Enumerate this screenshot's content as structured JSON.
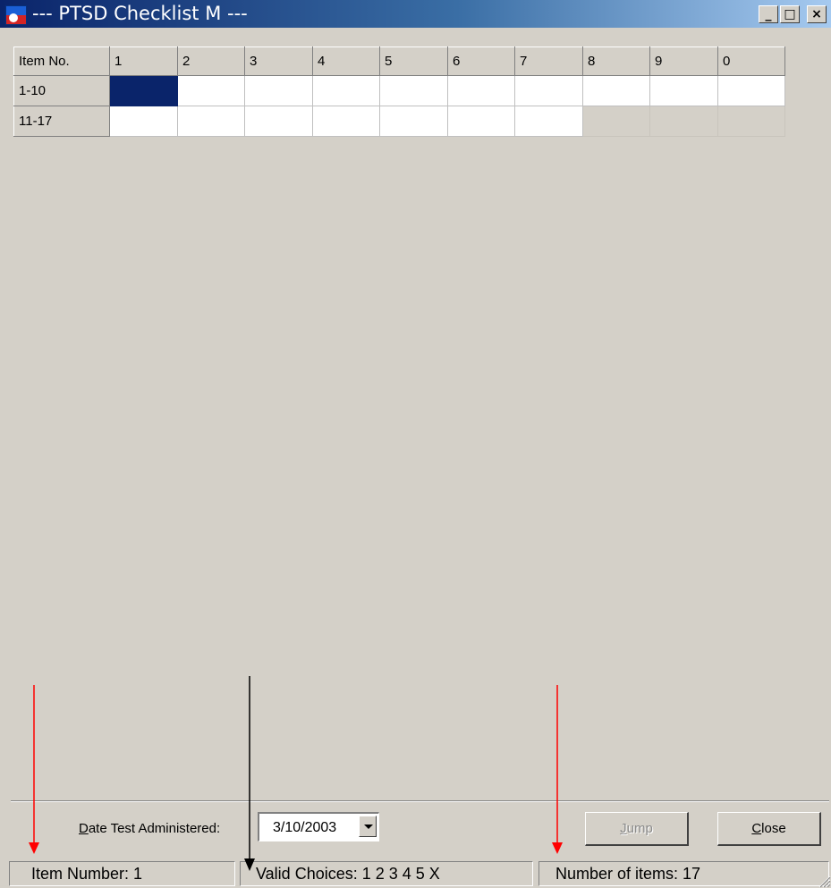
{
  "window": {
    "title": "--- PTSD Checklist M ---",
    "buttons": {
      "minimize": "_",
      "maximize": "□",
      "close": "×"
    }
  },
  "grid": {
    "header_label": "Item No.",
    "columns": [
      "1",
      "2",
      "3",
      "4",
      "5",
      "6",
      "7",
      "8",
      "9",
      "0"
    ],
    "rows": [
      {
        "label": "1-10",
        "cells": [
          "",
          "",
          "",
          "",
          "",
          "",
          "",
          "",
          "",
          ""
        ],
        "selected_index": 0,
        "available": 10
      },
      {
        "label": "11-17",
        "cells": [
          "",
          "",
          "",
          "",
          "",
          "",
          "",
          "",
          "",
          ""
        ],
        "available": 7
      }
    ]
  },
  "date_field": {
    "label_prefix_underlined": "D",
    "label_rest": "ate Test Administered:",
    "value": "3/10/2003"
  },
  "buttons": {
    "jump_underlined": "J",
    "jump_rest": "ump",
    "close_underlined": "C",
    "close_rest": "lose"
  },
  "status": {
    "item_number": "Item Number: 1",
    "valid_choices": "Valid Choices:  1 2 3 4 5 X",
    "number_of_items": "Number of items: 17"
  },
  "colors": {
    "selection": "#0a246a",
    "annotation_red": "#ff0000",
    "annotation_black": "#000000"
  }
}
